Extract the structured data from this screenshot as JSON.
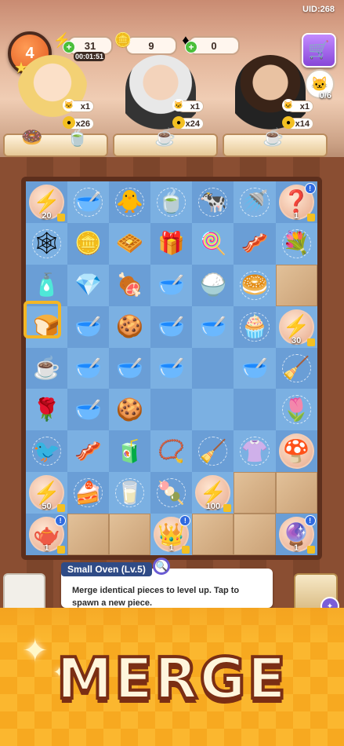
{
  "header": {
    "uid": "UID:268",
    "level": "4",
    "energy": "31",
    "timer": "00:01:51",
    "coins": "9",
    "gems": "0",
    "plus": "+",
    "quest_progress": "0/6"
  },
  "orders": [
    {
      "req_count": "x1",
      "reward": "x26"
    },
    {
      "req_count": "x1",
      "reward": "x24"
    },
    {
      "req_count": "x1",
      "reward": "x14"
    }
  ],
  "board": {
    "rows": [
      [
        {
          "icon": "⚡",
          "bubble": true,
          "num": "20"
        },
        {
          "icon": "🥣",
          "web": true
        },
        {
          "icon": "🐥",
          "web": true
        },
        {
          "icon": "🍵",
          "web": true
        },
        {
          "icon": "🐄",
          "web": true
        },
        {
          "icon": "🚿",
          "web": true
        },
        {
          "icon": "❓",
          "bubble": true,
          "num": "1",
          "alert": true
        }
      ],
      [
        {
          "icon": "🕸",
          "web": true
        },
        {
          "icon": "🪙"
        },
        {
          "icon": "🧇"
        },
        {
          "icon": "🎁"
        },
        {
          "icon": "🍭"
        },
        {
          "icon": "🥓"
        },
        {
          "icon": "💐",
          "web": true
        }
      ],
      [
        {
          "icon": "🧴"
        },
        {
          "icon": "💎"
        },
        {
          "icon": "🍖"
        },
        {
          "icon": "🥣"
        },
        {
          "icon": "🍚"
        },
        {
          "icon": "🥯",
          "web": true
        },
        {
          "icon": "",
          "box": true
        }
      ],
      [
        {
          "icon": "🍞"
        },
        {
          "icon": "🥣"
        },
        {
          "icon": "🍪"
        },
        {
          "icon": "🥣"
        },
        {
          "icon": "🥣"
        },
        {
          "icon": "🧁",
          "web": true
        },
        {
          "icon": "⚡",
          "bubble": true,
          "num": "30"
        }
      ],
      [
        {
          "icon": "☕"
        },
        {
          "icon": "🥣"
        },
        {
          "icon": "🥣"
        },
        {
          "icon": "🥣"
        },
        {
          "icon": ""
        },
        {
          "icon": "🥣"
        },
        {
          "icon": "🧹",
          "web": true
        }
      ],
      [
        {
          "icon": "🌹"
        },
        {
          "icon": "🥣"
        },
        {
          "icon": "🍪"
        },
        {
          "icon": ""
        },
        {
          "icon": ""
        },
        {
          "icon": ""
        },
        {
          "icon": "🌷",
          "web": true
        }
      ],
      [
        {
          "icon": "🐦",
          "web": true
        },
        {
          "icon": "🥓"
        },
        {
          "icon": "🧃"
        },
        {
          "icon": "📿"
        },
        {
          "icon": "🧹",
          "web": true
        },
        {
          "icon": "👚",
          "web": true
        },
        {
          "icon": "🍄",
          "bubble": true
        }
      ],
      [
        {
          "icon": "⚡",
          "bubble": true,
          "num": "50"
        },
        {
          "icon": "🍰",
          "web": true
        },
        {
          "icon": "🥛",
          "web": true
        },
        {
          "icon": "🍡",
          "web": true
        },
        {
          "icon": "⚡",
          "bubble": true,
          "num": "100"
        },
        {
          "icon": "",
          "box": true
        },
        {
          "icon": "",
          "box": true
        }
      ],
      [
        {
          "icon": "🫖",
          "bubble": true,
          "num": "1",
          "alert": true
        },
        {
          "icon": "",
          "box": true
        },
        {
          "icon": "",
          "box": true
        },
        {
          "icon": "👑",
          "bubble": true,
          "num": "1",
          "alert": true
        },
        {
          "icon": "",
          "box": true
        },
        {
          "icon": "",
          "box": true
        },
        {
          "icon": "🔮",
          "bubble": true,
          "num": "1",
          "alert": true
        }
      ]
    ]
  },
  "info": {
    "title": "Small Oven (Lv.5)",
    "description": "Merge identical pieces to level up. Tap to spawn a new piece."
  },
  "banner": {
    "text": "MERGE"
  },
  "colors": {
    "tile_a": "#6a9ed6",
    "tile_b": "#7bb0e2",
    "accent": "#f3b626"
  }
}
